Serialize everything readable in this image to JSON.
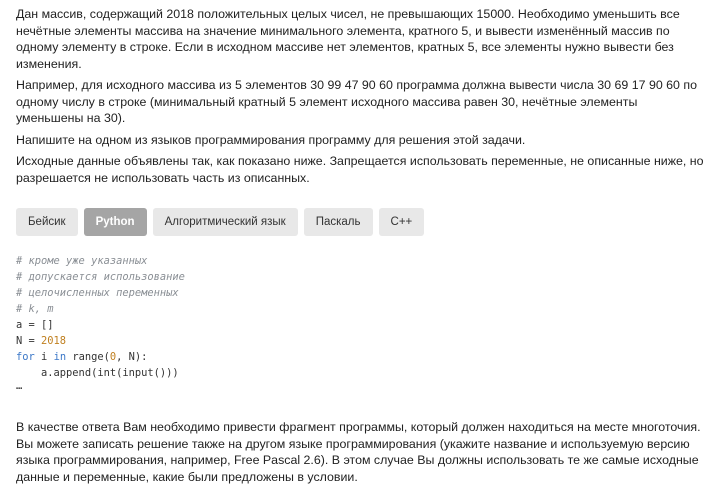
{
  "task": {
    "p1": "Дан массив, содержащий 2018 положительных целых чисел, не превышающих 15000. Необходимо уменьшить все нечётные элементы массива на значение минимального элемента, кратного 5, и вывести изменённый массив по одному элементу в строке. Если в исходном массиве нет элементов, кратных 5, все элементы нужно вывести без изменения.",
    "p2": "Например, для исходного массива из 5 элементов 30 99 47 90 60 программа должна вывести числа 30 69 17 90 60 по одному числу в строке (минимальный кратный 5 элемент исходного массива равен 30, нечётные элементы уменьшены на 30).",
    "p3": "Напишите на одном из языков программирования программу для решения этой задачи.",
    "p4": "Исходные данные объявлены так, как показано ниже. Запрещается использовать переменные, не описанные ниже, но разрешается не использовать часть из описанных."
  },
  "tabs": [
    {
      "label": "Бейсик",
      "active": false
    },
    {
      "label": "Python",
      "active": true
    },
    {
      "label": "Алгоритмический язык",
      "active": false
    },
    {
      "label": "Паскаль",
      "active": false
    },
    {
      "label": "C++",
      "active": false
    }
  ],
  "code": {
    "c1": "# кроме уже указанных",
    "c2": "# допускается использование",
    "c3": "# целочисленных переменных",
    "c4": "# k, m",
    "l5": "a = []",
    "l6a": "N = ",
    "l6b": "2018",
    "l7kw1": "for",
    "l7a": " i ",
    "l7kw2": "in",
    "l7b": " range(",
    "l7n": "0",
    "l7c": ", N):",
    "l8": "    a.append(int(input()))",
    "ellipsis": "…"
  },
  "answer": "В качестве ответа Вам необходимо привести фрагмент программы, который должен находиться на месте многоточия. Вы можете записать решение также на другом языке программирования (укажите название и используемую версию языка программирования, например, Free Pascal 2.6). В этом случае Вы должны использовать те же самые исходные данные и переменные, какие были предложены в условии."
}
